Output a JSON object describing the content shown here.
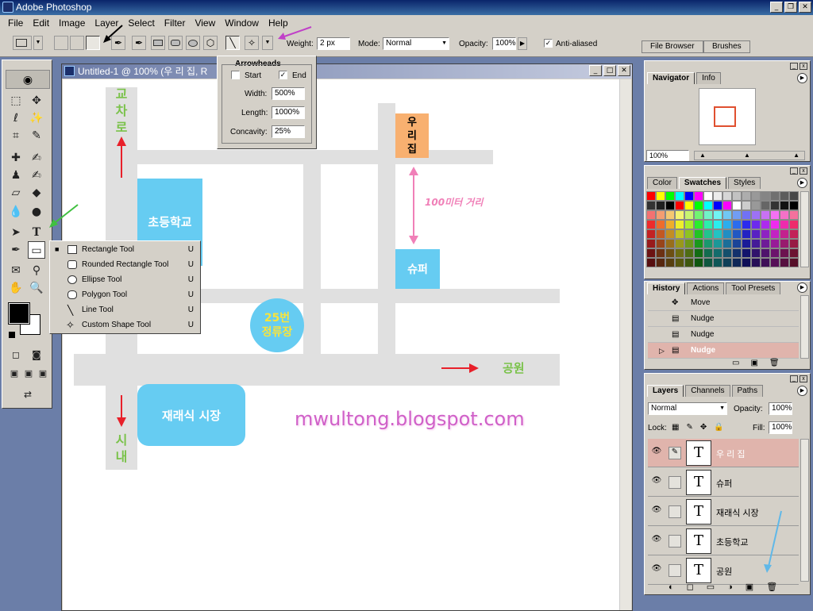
{
  "app": {
    "title": "Adobe Photoshop"
  },
  "menu": [
    "File",
    "Edit",
    "Image",
    "Layer",
    "Select",
    "Filter",
    "View",
    "Window",
    "Help"
  ],
  "options": {
    "weight_label": "Weight:",
    "weight_value": "2 px",
    "mode_label": "Mode:",
    "mode_value": "Normal",
    "opacity_label": "Opacity:",
    "opacity_value": "100%",
    "antialiased_label": "Anti-aliased",
    "tabs": [
      "File Browser",
      "Brushes"
    ]
  },
  "document": {
    "title": "Untitled-1 @ 100% (우 리 집, R"
  },
  "arrowheads": {
    "title": "Arrowheads",
    "start_label": "Start",
    "end_label": "End",
    "width_label": "Width:",
    "width_value": "500%",
    "length_label": "Length:",
    "length_value": "1000%",
    "concavity_label": "Concavity:",
    "concavity_value": "25%"
  },
  "shape_menu": [
    {
      "label": "Rectangle Tool",
      "key": "U"
    },
    {
      "label": "Rounded Rectangle Tool",
      "key": "U"
    },
    {
      "label": "Ellipse Tool",
      "key": "U"
    },
    {
      "label": "Polygon Tool",
      "key": "U"
    },
    {
      "label": "Line Tool",
      "key": "U"
    },
    {
      "label": "Custom Shape Tool",
      "key": "U"
    }
  ],
  "map": {
    "north_chars": [
      "교",
      "차",
      "로"
    ],
    "south_chars": [
      "시",
      "내"
    ],
    "home_chars": [
      "우",
      "리",
      "집"
    ],
    "school": "초등학교",
    "super": "슈퍼",
    "distance": "100미터 거리",
    "bus_line1": "25번",
    "bus_line2": "정류장",
    "market": "재래식 시장",
    "park": "공원",
    "watermark": "mwultong.blogspot.com"
  },
  "navigator": {
    "tabs": [
      "Navigator",
      "Info"
    ],
    "zoom": "100%"
  },
  "swatches": {
    "tabs": [
      "Color",
      "Swatches",
      "Styles"
    ]
  },
  "history": {
    "tabs": [
      "History",
      "Actions",
      "Tool Presets"
    ],
    "items": [
      "Move",
      "Nudge",
      "Nudge",
      "Nudge"
    ]
  },
  "layers": {
    "tabs": [
      "Layers",
      "Channels",
      "Paths"
    ],
    "blend": "Normal",
    "opacity_label": "Opacity:",
    "opacity_value": "100%",
    "lock_label": "Lock:",
    "fill_label": "Fill:",
    "fill_value": "100%",
    "items": [
      "우 리 집",
      "슈퍼",
      "재래식 시장",
      "초등학교",
      "공원"
    ]
  },
  "colors": {
    "swatch_blue": "#66ccf2",
    "home_orange": "#f8b070",
    "text_green": "#7ac24a",
    "arrow_red": "#e8202a",
    "arrow_pink": "#f080b8",
    "active_layer": "#e0b4ac"
  }
}
